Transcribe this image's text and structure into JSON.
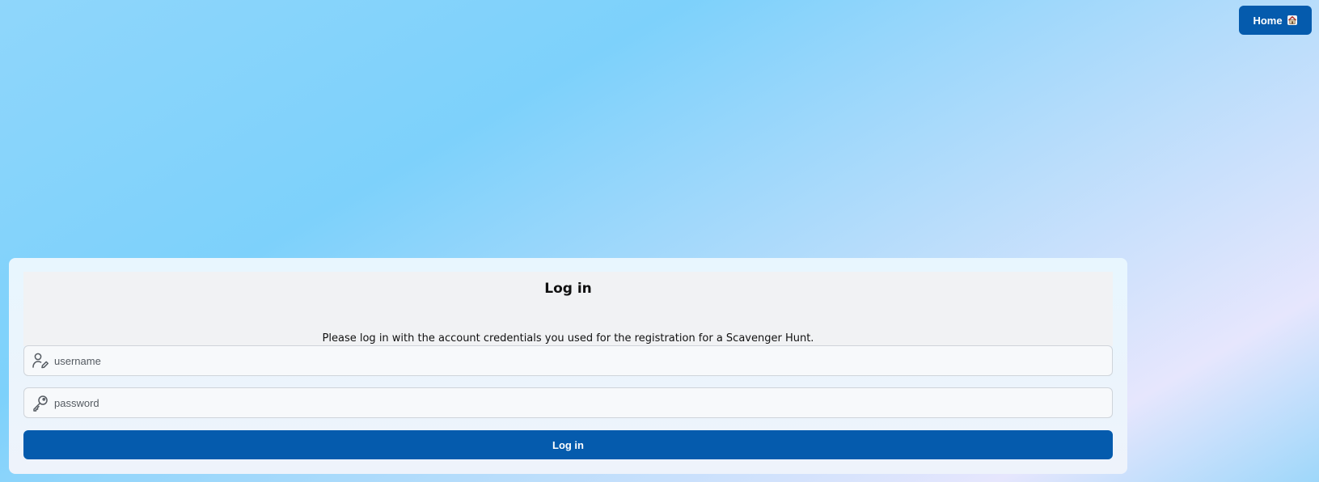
{
  "nav": {
    "home_label": "Home",
    "home_icon": "house-icon"
  },
  "login": {
    "title": "Log in",
    "description": "Please log in with the account credentials you used for the registration for a Scavenger Hunt.",
    "username": {
      "placeholder": "username",
      "value": "",
      "icon": "user-edit-icon"
    },
    "password": {
      "placeholder": "password",
      "value": "",
      "icon": "key-icon"
    },
    "submit_label": "Log in"
  },
  "colors": {
    "primary": "#055bad",
    "panel_header": "#f1f2f4",
    "input_border": "#cfd4da"
  }
}
